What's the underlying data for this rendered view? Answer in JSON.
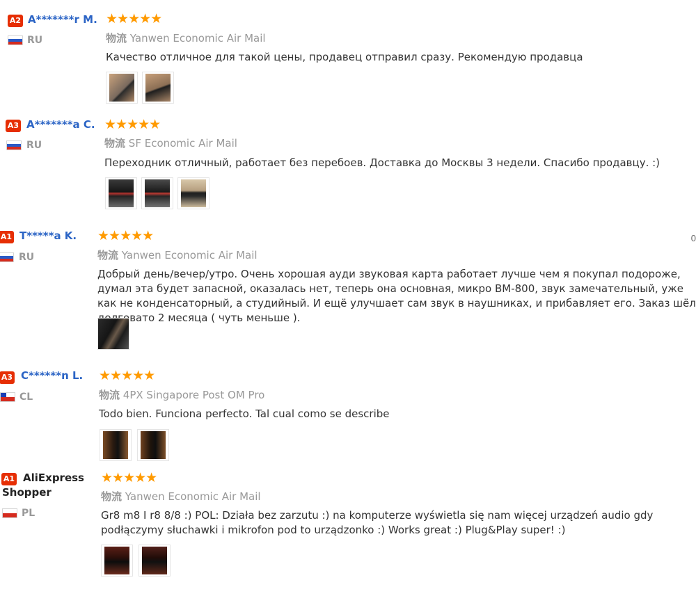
{
  "reviews": [
    {
      "badge": "A2",
      "name": "A*******r M.",
      "country": "RU",
      "rating": 5,
      "shipping_label": "物流",
      "shipping": "Yanwen Economic Air Mail",
      "text": "Качество отличное для такой цены, продавец отправил сразу. Рекомендую продавца",
      "photos": [
        "photo-1",
        "photo-2"
      ]
    },
    {
      "badge": "A3",
      "name": "A*******a C.",
      "country": "RU",
      "rating": 5,
      "shipping_label": "物流",
      "shipping": "SF Economic Air Mail",
      "text": "Переходник отличный, работает без перебоев. Доставка до Москвы 3 недели. Спасибо продавцу. :)",
      "photos": [
        "photo-1",
        "photo-2",
        "photo-3"
      ]
    },
    {
      "badge": "A1",
      "name": "T*****a K.",
      "country": "RU",
      "rating": 5,
      "shipping_label": "物流",
      "shipping": "Yanwen Economic Air Mail",
      "text": "Добрый день/вечер/утро. Очень хорошая ауди звуковая карта работает лучше чем я покупал подороже, думал эта будет запасной, оказалась нет, теперь она основная, микро BM-800, звук замечательный, уже как не конденсаторный, а студийный. И ещё улучшает сам звук в наушниках, и прибавляет его. Заказ шёл долговато 2 месяца ( чуть меньше ).",
      "photos": [
        "photo-1"
      ],
      "edge_text": "0"
    },
    {
      "badge": "A3",
      "name": "C******n L.",
      "country": "CL",
      "rating": 5,
      "shipping_label": "物流",
      "shipping": "4PX Singapore Post OM Pro",
      "text": "Todo bien. Funciona perfecto. Tal cual como se describe",
      "photos": [
        "photo-1",
        "photo-2"
      ]
    },
    {
      "badge": "A1",
      "name": "AliExpress Shopper",
      "country": "PL",
      "rating": 5,
      "shipping_label": "物流",
      "shipping": "Yanwen Economic Air Mail",
      "text": "Gr8 m8 I r8 8/8 :) POL: Działa bez zarzutu :) na komputerze wyświetla się nam więcej urządzeń audio gdy podłączymy słuchawki i mikrofon pod to urządzonko :) Works great :) Plug&Play super! :)",
      "photos": [
        "photo-1",
        "photo-2"
      ]
    }
  ],
  "colors": {
    "badge": "#e62e04",
    "name": "#2b64c5",
    "star": "#ff9a00",
    "muted": "#999999"
  },
  "star_glyph": "★★★★★"
}
